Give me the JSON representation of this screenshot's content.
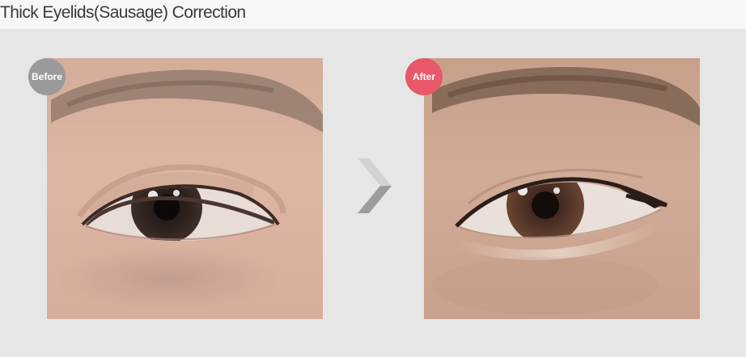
{
  "header": {
    "title": "Thick Eyelids(Sausage) Correction"
  },
  "photos": {
    "before": {
      "badge": "Before",
      "description": "eye-photo-before"
    },
    "after": {
      "badge": "After",
      "description": "eye-photo-after"
    }
  },
  "icons": {
    "arrow": "chevron-right-icon"
  },
  "colors": {
    "background": "#e6e6e6",
    "header_background": "#f7f7f7",
    "before_badge": "#9a9a9a",
    "after_badge": "#e8576a",
    "arrow_light": "#d2d2d2",
    "arrow_dark": "#9c9c9c"
  }
}
